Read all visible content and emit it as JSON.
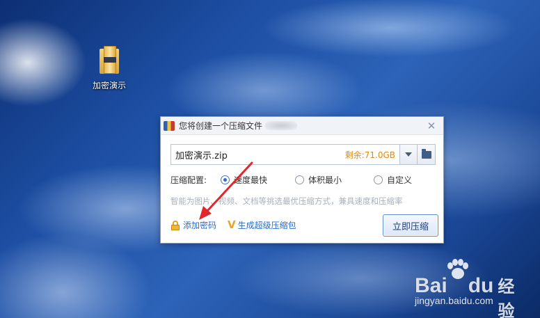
{
  "desktop": {
    "icons": [
      {
        "label": "加密演示",
        "icon": "zip-archive-icon"
      }
    ]
  },
  "dialog": {
    "title": "您将创建一个压缩文件",
    "close_glyph": "✕",
    "path": {
      "value": "加密演示.zip",
      "free_space": "剩余:71.0GB"
    },
    "config": {
      "label": "压缩配置:",
      "options": [
        {
          "label": "速度最快",
          "checked": true
        },
        {
          "label": "体积最小",
          "checked": false
        },
        {
          "label": "自定义",
          "checked": false
        }
      ]
    },
    "hint": "智能为图片、视频、文档等挑选最优压缩方式，兼具速度和压缩率",
    "add_password_label": "添加密码",
    "super_package_label": "生成超级压缩包",
    "compress_button_label": "立即压缩"
  },
  "annotation": {
    "color": "#e3262b"
  },
  "watermark": {
    "brand_bai": "Bai",
    "brand_du": "du",
    "brand_jingyan": "经验",
    "url": "jingyan.baidu.com"
  },
  "colors": {
    "accent": "#2a6bc8",
    "free_space": "#e08a12",
    "hint": "#a9b0bd"
  }
}
